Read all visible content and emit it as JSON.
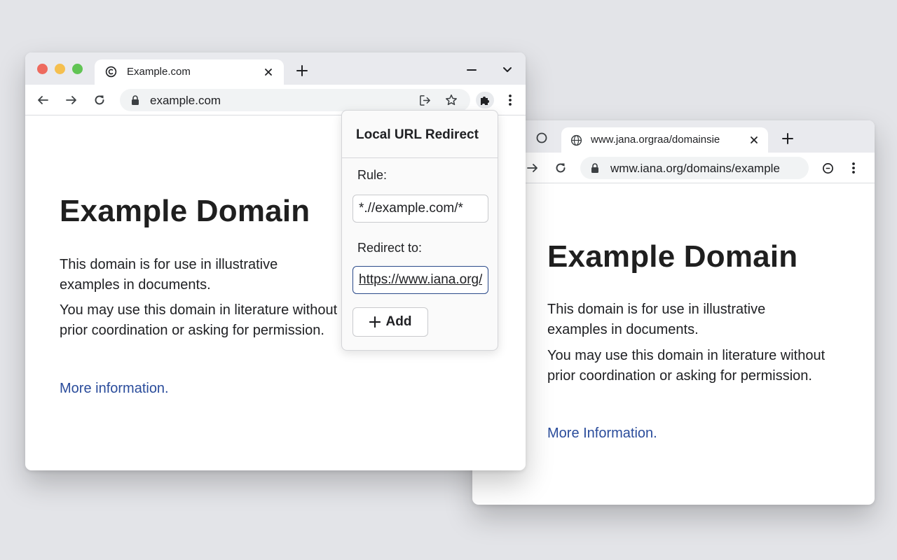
{
  "back_window": {
    "tab": {
      "title": "www.jana.orgraa/domainsie"
    },
    "address_bar": {
      "url": "wmw.iana.org/domains/example"
    },
    "page": {
      "heading": "Example Domain",
      "paragraph1": "This domain is for use in illustrative examples in documents.",
      "paragraph2": "You may use this domain in literature without prior coordination or asking for permission.",
      "link": "More Information."
    }
  },
  "front_window": {
    "tab": {
      "title": "Example.com"
    },
    "address_bar": {
      "url": "example.com"
    },
    "page": {
      "heading": "Example Domain",
      "paragraph1": "This domain is for use in illustrative examples in documents.",
      "paragraph2": "You may use this domain in literature without prior coordination or asking for permission.",
      "link": "More information."
    }
  },
  "extension_popup": {
    "title": "Local URL Redirect",
    "rule_label": "Rule:",
    "rule_value": "*.//example.com/*",
    "redirect_label": "Redirect to:",
    "redirect_value": "https://www.iana.org/domains/example",
    "add_label": "Add"
  },
  "icons": {
    "tab_favicon_front": "copyright-circle-icon",
    "tab_favicon_back": "globe-icon",
    "new_tab": "plus-icon",
    "close_tab": "close-icon",
    "back": "arrow-left-icon",
    "forward": "arrow-right-icon",
    "reload": "reload-icon",
    "lock": "lock-icon",
    "share": "share-icon",
    "bookmark": "star-icon",
    "extensions": "puzzle-icon",
    "menu": "kebab-menu-icon"
  },
  "colors": {
    "background": "#e3e4e8",
    "traffic_red": "#ee6a5e",
    "traffic_yellow": "#f5bf4f",
    "traffic_green": "#61c454",
    "link": "#2a4c9b",
    "input_focus": "#2b4a8a"
  }
}
